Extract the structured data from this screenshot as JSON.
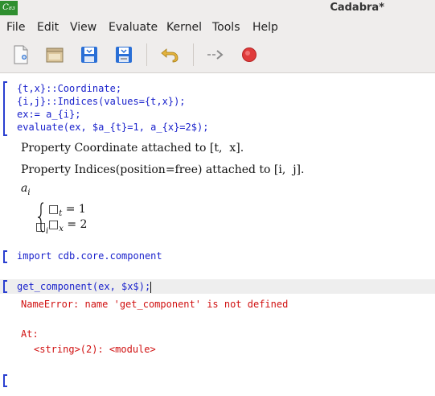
{
  "window": {
    "title": "Cadabra*",
    "icon_text": "C₈₃"
  },
  "menu": [
    "File",
    "Edit",
    "View",
    "Evaluate",
    "Kernel",
    "Tools",
    "Help"
  ],
  "toolbar": {
    "icons": [
      "new-document-icon",
      "open-folder-icon",
      "save-icon",
      "save-as-icon",
      "undo-icon",
      "run-icon",
      "stop-icon"
    ],
    "colors": {
      "save": "#2a6fd6",
      "undo": "#e3b23c",
      "stop": "#e03b3b"
    }
  },
  "cells": {
    "cell1_code": [
      "{t,x}::Coordinate;",
      "{i,j}::Indices(values={t,x});",
      "ex:= a_{i};",
      "evaluate(ex, $a_{t}=1, a_{x}=2$);"
    ],
    "out1": "Property Coordinate attached to [t,  x].",
    "out2": "Property Indices(position=free) attached to [i,  j].",
    "out3_base": "a",
    "out3_sub": "i",
    "out4_box": "□",
    "out4_sub": "i",
    "out4_row1": "□",
    "out4_row1_sub": "t",
    "out4_row1_val": "= 1",
    "out4_row2": "□",
    "out4_row2_sub": "x",
    "out4_row2_val": "= 2",
    "cell2_code": "import cdb.core.component",
    "cell3_code": "get_component(ex, $x$);",
    "err1": "NameError: name 'get_component' is not defined",
    "err2": "At:",
    "err3": "<string>(2): <module>"
  }
}
